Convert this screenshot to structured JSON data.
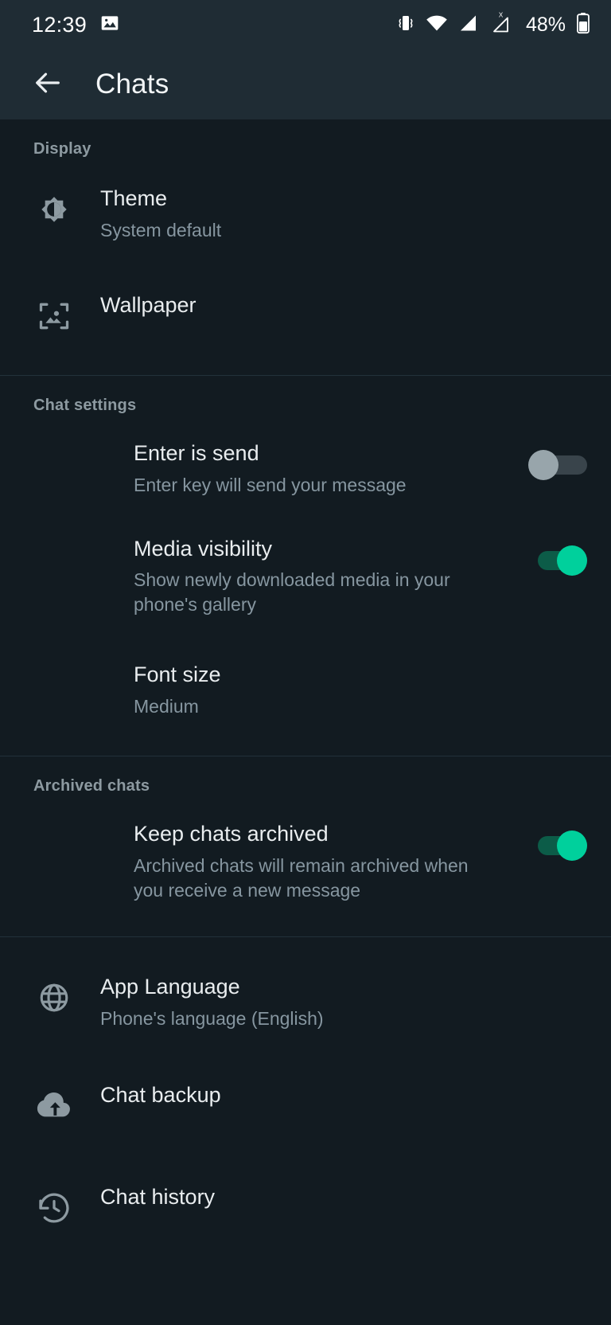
{
  "status_bar": {
    "time": "12:39",
    "battery_percent": "48%",
    "icons": [
      "image-icon",
      "vibrate-icon",
      "wifi-icon",
      "signal-icon",
      "no-sim-signal-icon",
      "battery-icon"
    ]
  },
  "app_bar": {
    "back_label": "back-arrow",
    "title": "Chats"
  },
  "sections": [
    {
      "title": "Display",
      "rows": [
        {
          "icon": "brightness-icon",
          "title": "Theme",
          "subtitle": "System default"
        },
        {
          "icon": "wallpaper-icon",
          "title": "Wallpaper",
          "subtitle": ""
        }
      ]
    },
    {
      "title": "Chat settings",
      "rows": [
        {
          "icon": "",
          "title": "Enter is send",
          "subtitle": "Enter key will send your message",
          "toggle": "off"
        },
        {
          "icon": "",
          "title": "Media visibility",
          "subtitle": "Show newly downloaded media in your phone's gallery",
          "toggle": "on"
        },
        {
          "icon": "",
          "title": "Font size",
          "subtitle": "Medium"
        }
      ]
    },
    {
      "title": "Archived chats",
      "rows": [
        {
          "icon": "",
          "title": "Keep chats archived",
          "subtitle": "Archived chats will remain archived when you receive a new message",
          "toggle": "on"
        }
      ]
    },
    {
      "title": "",
      "rows": [
        {
          "icon": "globe-icon",
          "title": "App Language",
          "subtitle": "Phone's language (English)"
        },
        {
          "icon": "cloud-upload-icon",
          "title": "Chat backup",
          "subtitle": ""
        },
        {
          "icon": "history-icon",
          "title": "Chat history",
          "subtitle": ""
        }
      ]
    }
  ],
  "colors": {
    "background": "#121b21",
    "appbar": "#1f2c34",
    "accent_green": "#00d09c",
    "toggle_off_thumb": "#98a5ab",
    "primary_text": "#e9edef",
    "secondary_text": "#8696a0"
  }
}
